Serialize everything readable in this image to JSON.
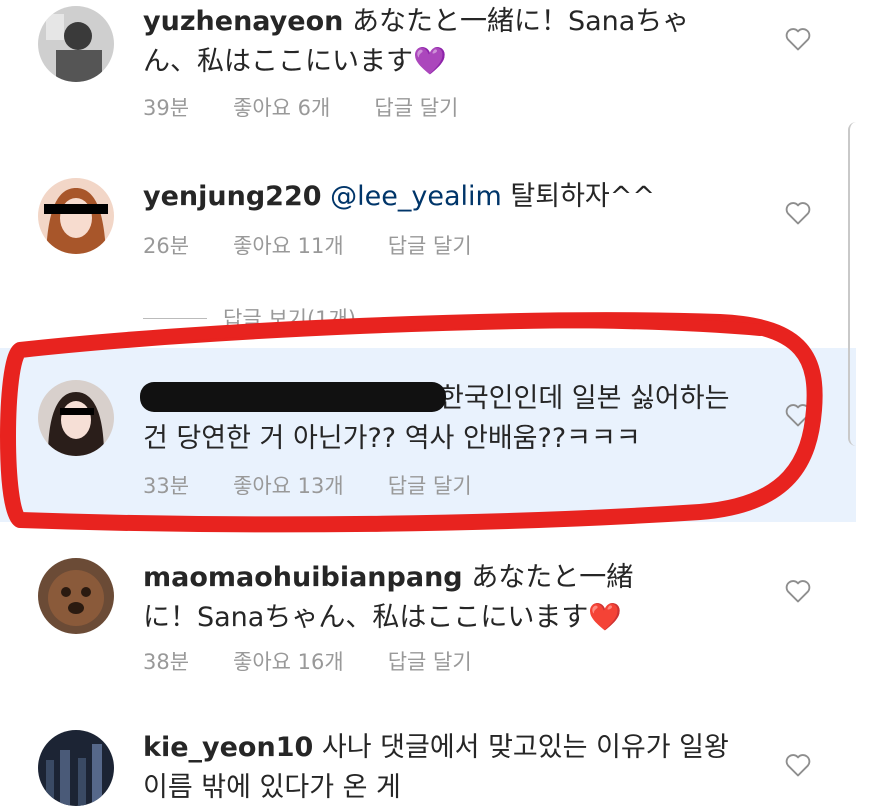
{
  "comments": [
    {
      "username": "yuzhenayeon",
      "text": "あなたと一緒に！Sanaちゃん、私はここにいます",
      "emoji": "💜",
      "time": "39분",
      "likes": "좋아요 6개",
      "reply": "답글 달기"
    },
    {
      "username": "yenjung220",
      "mention": "@lee_yealim",
      "text": "탈퇴하자^^",
      "time": "26분",
      "likes": "좋아요 11개",
      "reply": "답글 달기",
      "view_replies": "답글 보기(1개)"
    },
    {
      "username": "",
      "text": "한국인인데 일본 싫어하는 건 당연한 거 아닌가?? 역사 안배움??ㅋㅋㅋ",
      "time": "33분",
      "likes": "좋아요 13개",
      "reply": "답글 달기"
    },
    {
      "username": "maomaohuibianpang",
      "text": "あなたと一緒に！Sanaちゃん、私はここにいます",
      "emoji": "❤️",
      "time": "38분",
      "likes": "좋아요 16개",
      "reply": "답글 달기"
    },
    {
      "username": "kie_yeon10",
      "text": "사나 댓글에서 맞고있는 이유가 일왕",
      "text_cut": "이름 밖에 있다가 온 게"
    }
  ],
  "colors": {
    "highlight_bg": "#e9f2fd",
    "annotation_red": "#e8231f",
    "meta_text": "#999999",
    "mention": "#003569"
  },
  "icons": [
    "heart-outline-icon",
    "avatar"
  ]
}
